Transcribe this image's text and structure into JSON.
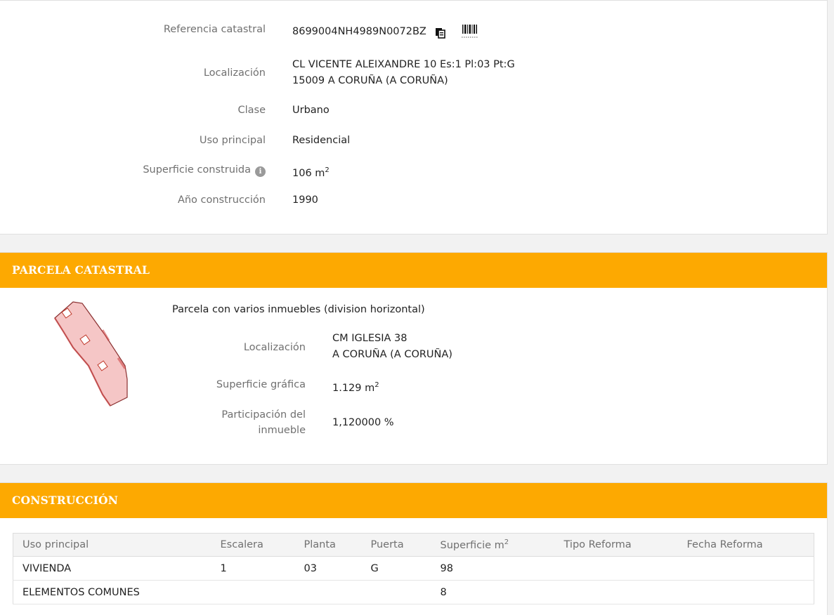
{
  "datos": {
    "referencia": {
      "label": "Referencia catastral",
      "value": "8699004NH4989N0072BZ"
    },
    "localizacion": {
      "label": "Localización",
      "line1": "CL VICENTE ALEIXANDRE 10 Es:1 Pl:03 Pt:G",
      "line2": "15009 A CORUÑA (A CORUÑA)"
    },
    "clase": {
      "label": "Clase",
      "value": "Urbano"
    },
    "uso": {
      "label": "Uso principal",
      "value": "Residencial"
    },
    "superficie": {
      "label": "Superficie construida",
      "value": "106 m",
      "unit_sup": "2"
    },
    "anio": {
      "label": "Año construcción",
      "value": "1990"
    }
  },
  "parcela": {
    "header": "PARCELA CATASTRAL",
    "descripcion": "Parcela con varios inmuebles (division horizontal)",
    "localizacion": {
      "label": "Localización",
      "line1": "CM IGLESIA 38",
      "line2": "A CORUÑA (A CORUÑA)"
    },
    "superficie": {
      "label": "Superficie gráfica",
      "value": "1.129 m",
      "unit_sup": "2"
    },
    "participacion": {
      "label_line1": "Participación del",
      "label_line2": "inmueble",
      "value": "1,120000 %"
    }
  },
  "construccion": {
    "header": "CONSTRUCCIÓN",
    "columns": [
      "Uso principal",
      "Escalera",
      "Planta",
      "Puerta",
      "Superficie m",
      "Tipo Reforma",
      "Fecha Reforma"
    ],
    "superficie_col_sup": "2",
    "rows": [
      [
        "VIVIENDA",
        "1",
        "03",
        "G",
        "98",
        "",
        ""
      ],
      [
        "ELEMENTOS COMUNES",
        "",
        "",
        "",
        "8",
        "",
        ""
      ]
    ]
  },
  "colors": {
    "header_bg": "#fda901",
    "parcel_fill": "#f5c6c6",
    "parcel_stroke": "#c0392b"
  }
}
